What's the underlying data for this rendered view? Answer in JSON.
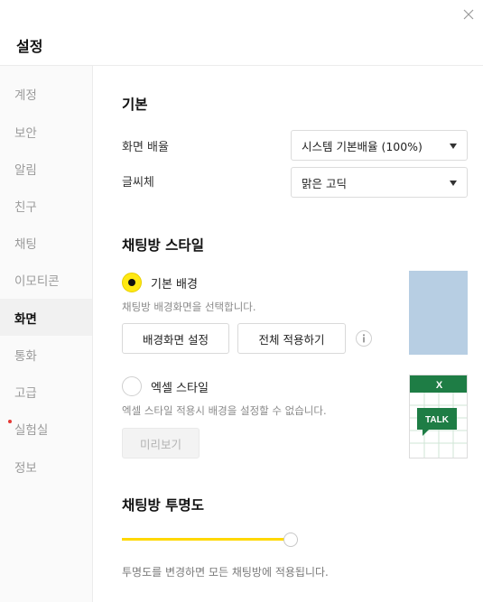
{
  "window": {
    "title": "설정",
    "close_icon": "close-icon"
  },
  "sidebar": {
    "items": [
      {
        "label": "계정",
        "active": false,
        "new": false
      },
      {
        "label": "보안",
        "active": false,
        "new": false
      },
      {
        "label": "알림",
        "active": false,
        "new": false
      },
      {
        "label": "친구",
        "active": false,
        "new": false
      },
      {
        "label": "채팅",
        "active": false,
        "new": false
      },
      {
        "label": "이모티콘",
        "active": false,
        "new": false
      },
      {
        "label": "화면",
        "active": true,
        "new": false
      },
      {
        "label": "통화",
        "active": false,
        "new": false
      },
      {
        "label": "고급",
        "active": false,
        "new": false
      },
      {
        "label": "실험실",
        "active": false,
        "new": true
      },
      {
        "label": "정보",
        "active": false,
        "new": false
      }
    ]
  },
  "basic": {
    "title": "기본",
    "screen_ratio": {
      "label": "화면 배율",
      "value": "시스템 기본배율 (100%)"
    },
    "font": {
      "label": "글씨체",
      "value": "맑은 고딕"
    }
  },
  "chat_style": {
    "title": "채팅방 스타일",
    "default_bg": {
      "label": "기본 배경",
      "selected": true,
      "hint": "채팅방 배경화면을 선택합니다.",
      "set_bg_button": "배경화면 설정",
      "apply_all_button": "전체 적용하기",
      "preview_color": "#b7cee3"
    },
    "excel": {
      "label": "엑셀 스타일",
      "selected": false,
      "hint": "엑셀 스타일 적용시 배경을 설정할 수 없습니다.",
      "preview_button": "미리보기",
      "preview_header": "X",
      "preview_bubble": "TALK",
      "preview_color": "#1e7d45"
    }
  },
  "transparency": {
    "title": "채팅방 투명도",
    "level_percent": 100,
    "hint": "투명도를 변경하면 모든 채팅방에 적용됩니다."
  },
  "colors": {
    "accent": "#ffe812",
    "slider": "#ffd800",
    "excel_green": "#1e7d45"
  }
}
